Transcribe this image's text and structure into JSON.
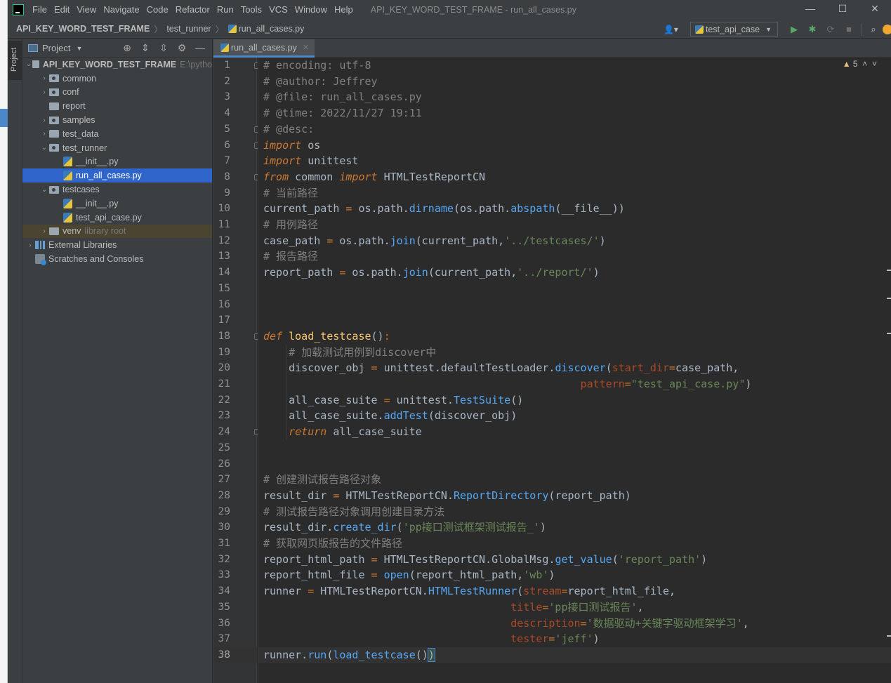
{
  "window": {
    "menu": [
      "File",
      "Edit",
      "View",
      "Navigate",
      "Code",
      "Refactor",
      "Run",
      "Tools",
      "VCS",
      "Window",
      "Help"
    ],
    "title": "API_KEY_WORD_TEST_FRAME - run_all_cases.py",
    "controls": [
      "—",
      "☐",
      "✕"
    ]
  },
  "navbar": {
    "crumbs": [
      "API_KEY_WORD_TEST_FRAME",
      "test_runner",
      "run_all_cases.py"
    ],
    "run_config": "test_api_case"
  },
  "project_panel": {
    "title": "Project",
    "vertical_tab": "Project",
    "tree": [
      {
        "depth": 0,
        "arrow": "v",
        "icon": "folder",
        "label": "API_KEY_WORD_TEST_FRAME",
        "extra": "E:\\pytho"
      },
      {
        "depth": 1,
        "arrow": ">",
        "icon": "pkg",
        "label": "common"
      },
      {
        "depth": 1,
        "arrow": ">",
        "icon": "pkg",
        "label": "conf"
      },
      {
        "depth": 1,
        "arrow": "",
        "icon": "folder",
        "label": "report"
      },
      {
        "depth": 1,
        "arrow": ">",
        "icon": "pkg",
        "label": "samples"
      },
      {
        "depth": 1,
        "arrow": ">",
        "icon": "folder",
        "label": "test_data"
      },
      {
        "depth": 1,
        "arrow": "v",
        "icon": "pkg",
        "label": "test_runner"
      },
      {
        "depth": 2,
        "arrow": "",
        "icon": "py",
        "label": "__init__.py"
      },
      {
        "depth": 2,
        "arrow": "",
        "icon": "py",
        "label": "run_all_cases.py",
        "selected": true
      },
      {
        "depth": 1,
        "arrow": "v",
        "icon": "pkg",
        "label": "testcases"
      },
      {
        "depth": 2,
        "arrow": "",
        "icon": "py",
        "label": "__init__.py"
      },
      {
        "depth": 2,
        "arrow": "",
        "icon": "py",
        "label": "test_api_case.py"
      },
      {
        "depth": 1,
        "arrow": ">",
        "icon": "folder",
        "label": "venv",
        "extra": "library root",
        "venv": true
      },
      {
        "depth": 0,
        "arrow": ">",
        "icon": "lib",
        "label": "External Libraries"
      },
      {
        "depth": 0,
        "arrow": "",
        "icon": "scratch",
        "label": "Scratches and Consoles"
      }
    ]
  },
  "editor": {
    "tab": "run_all_cases.py",
    "warnings": "5",
    "current_line": 38,
    "lines": [
      [
        [
          "c-cm",
          "# encoding: utf-8"
        ]
      ],
      [
        [
          "c-cm",
          "# @author: Jeffrey"
        ]
      ],
      [
        [
          "c-cm",
          "# @file: run_all_cases.py"
        ]
      ],
      [
        [
          "c-cm",
          "# @time: 2022/11/27 19:11"
        ]
      ],
      [
        [
          "c-cm",
          "# @desc:"
        ]
      ],
      [
        [
          "c-kw",
          "import"
        ],
        [
          "c-plain",
          " os"
        ]
      ],
      [
        [
          "c-kw",
          "import"
        ],
        [
          "c-plain",
          " unittest"
        ]
      ],
      [
        [
          "c-kw",
          "from"
        ],
        [
          "c-plain",
          " common "
        ],
        [
          "c-kw",
          "import"
        ],
        [
          "c-plain",
          " HTMLTestReportCN"
        ]
      ],
      [
        [
          "c-cm",
          "# 当前路径"
        ]
      ],
      [
        [
          "c-plain",
          "current_path "
        ],
        [
          "c-kw2",
          "="
        ],
        [
          "c-plain",
          " os.path."
        ],
        [
          "c-call",
          "dirname"
        ],
        [
          "c-plain",
          "(os.path."
        ],
        [
          "c-call",
          "abspath"
        ],
        [
          "c-plain",
          "(__file__))"
        ]
      ],
      [
        [
          "c-cm",
          "# 用例路径"
        ]
      ],
      [
        [
          "c-plain",
          "case_path "
        ],
        [
          "c-kw2",
          "="
        ],
        [
          "c-plain",
          " os.path."
        ],
        [
          "c-call",
          "join"
        ],
        [
          "c-plain",
          "(current_path,"
        ],
        [
          "c-str",
          "'../testcases/'"
        ],
        [
          "c-plain",
          ")"
        ]
      ],
      [
        [
          "c-cm",
          "# 报告路径"
        ]
      ],
      [
        [
          "c-plain",
          "report_path "
        ],
        [
          "c-kw2",
          "="
        ],
        [
          "c-plain",
          " os.path."
        ],
        [
          "c-call",
          "join"
        ],
        [
          "c-plain",
          "(current_path,"
        ],
        [
          "c-str",
          "'../report/'"
        ],
        [
          "c-plain",
          ")"
        ]
      ],
      [],
      [],
      [],
      [
        [
          "c-def",
          "def"
        ],
        [
          "c-plain",
          " "
        ],
        [
          "c-fn",
          "load_testcase"
        ],
        [
          "c-plain",
          "()"
        ],
        [
          "c-kw2",
          ":"
        ]
      ],
      [
        [
          "c-plain",
          "    "
        ],
        [
          "c-cm",
          "# 加载测试用例到discover中"
        ]
      ],
      [
        [
          "c-plain",
          "    discover_obj "
        ],
        [
          "c-kw2",
          "="
        ],
        [
          "c-plain",
          " unittest.defaultTestLoader."
        ],
        [
          "c-call",
          "discover"
        ],
        [
          "c-plain",
          "("
        ],
        [
          "c-param",
          "start_dir"
        ],
        [
          "c-kw2",
          "="
        ],
        [
          "c-plain",
          "case_path,"
        ]
      ],
      [
        [
          "c-plain",
          "                                                  "
        ],
        [
          "c-param",
          "pattern"
        ],
        [
          "c-kw2",
          "="
        ],
        [
          "c-str",
          "\"test_api_case.py\""
        ],
        [
          "c-plain",
          ")"
        ]
      ],
      [
        [
          "c-plain",
          "    all_case_suite "
        ],
        [
          "c-kw2",
          "="
        ],
        [
          "c-plain",
          " unittest."
        ],
        [
          "c-call",
          "TestSuite"
        ],
        [
          "c-plain",
          "()"
        ]
      ],
      [
        [
          "c-plain",
          "    all_case_suite."
        ],
        [
          "c-call",
          "addTest"
        ],
        [
          "c-plain",
          "(discover_obj)"
        ]
      ],
      [
        [
          "c-plain",
          "    "
        ],
        [
          "c-kw",
          "return"
        ],
        [
          "c-plain",
          " all_case_suite"
        ]
      ],
      [],
      [],
      [
        [
          "c-cm",
          "# 创建测试报告路径对象"
        ]
      ],
      [
        [
          "c-plain",
          "result_dir "
        ],
        [
          "c-kw2",
          "="
        ],
        [
          "c-plain",
          " HTMLTestReportCN."
        ],
        [
          "c-call",
          "ReportDirectory"
        ],
        [
          "c-plain",
          "(report_path)"
        ]
      ],
      [
        [
          "c-cm",
          "# 测试报告路径对象调用创建目录方法"
        ]
      ],
      [
        [
          "c-plain",
          "result_dir."
        ],
        [
          "c-call",
          "create_dir"
        ],
        [
          "c-plain",
          "("
        ],
        [
          "c-str",
          "'pp接口测试框架测试报告_'"
        ],
        [
          "c-plain",
          ")"
        ]
      ],
      [
        [
          "c-cm",
          "# 获取网页版报告的文件路径"
        ]
      ],
      [
        [
          "c-plain",
          "report_html_path "
        ],
        [
          "c-kw2",
          "="
        ],
        [
          "c-plain",
          " HTMLTestReportCN.GlobalMsg."
        ],
        [
          "c-call",
          "get_value"
        ],
        [
          "c-plain",
          "("
        ],
        [
          "c-str",
          "'report_path'"
        ],
        [
          "c-plain",
          ")"
        ]
      ],
      [
        [
          "c-plain",
          "report_html_file "
        ],
        [
          "c-kw2",
          "="
        ],
        [
          "c-plain",
          " "
        ],
        [
          "c-call",
          "open"
        ],
        [
          "c-plain",
          "(report_html_path,"
        ],
        [
          "c-str",
          "'wb'"
        ],
        [
          "c-plain",
          ")"
        ]
      ],
      [
        [
          "c-plain",
          "runner "
        ],
        [
          "c-kw2",
          "="
        ],
        [
          "c-plain",
          " HTMLTestReportCN."
        ],
        [
          "c-call",
          "HTMLTestRunner"
        ],
        [
          "c-plain",
          "("
        ],
        [
          "c-param",
          "stream"
        ],
        [
          "c-kw2",
          "="
        ],
        [
          "c-plain",
          "report_html_file,"
        ]
      ],
      [
        [
          "c-plain",
          "                                       "
        ],
        [
          "c-param",
          "title"
        ],
        [
          "c-kw2",
          "="
        ],
        [
          "c-str",
          "'pp接口测试报告'"
        ],
        [
          "c-plain",
          ","
        ]
      ],
      [
        [
          "c-plain",
          "                                       "
        ],
        [
          "c-param",
          "description"
        ],
        [
          "c-kw2",
          "="
        ],
        [
          "c-str",
          "'数据驱动+关键字驱动框架学习'"
        ],
        [
          "c-plain",
          ","
        ]
      ],
      [
        [
          "c-plain",
          "                                       "
        ],
        [
          "c-param",
          "tester"
        ],
        [
          "c-kw2",
          "="
        ],
        [
          "c-str",
          "'jeff'"
        ],
        [
          "c-plain",
          ")"
        ]
      ],
      [
        [
          "c-plain",
          "runner."
        ],
        [
          "c-call",
          "run"
        ],
        [
          "c-plain",
          "("
        ],
        [
          "c-call",
          "load_testcase"
        ],
        [
          "c-plain",
          "()"
        ],
        [
          "c-plain",
          ")"
        ]
      ]
    ]
  }
}
